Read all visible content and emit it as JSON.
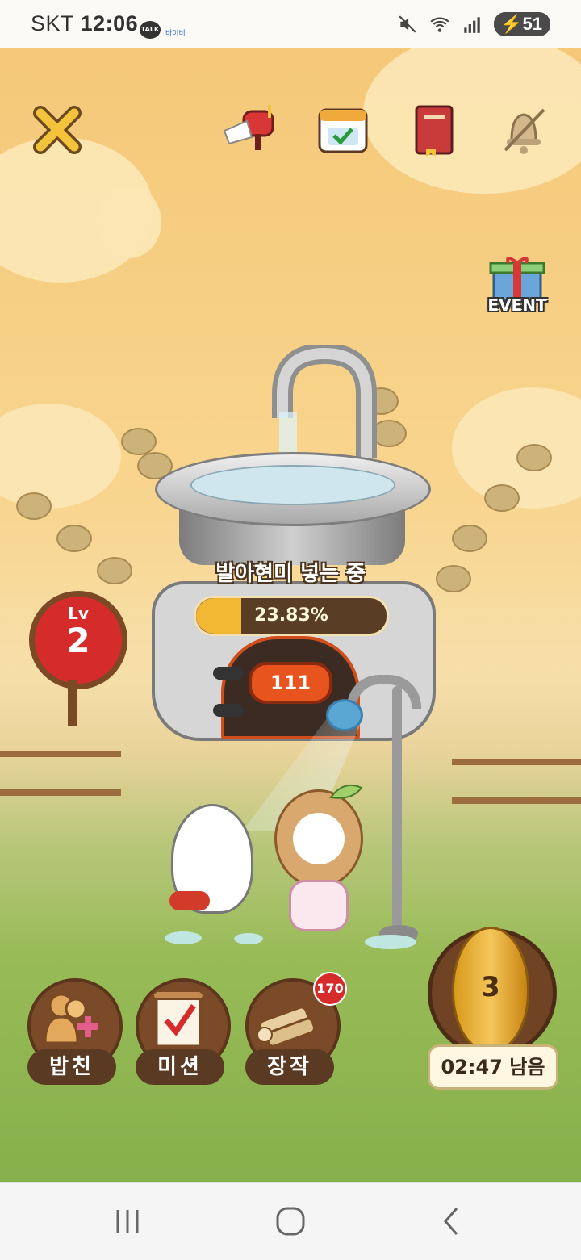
{
  "status_bar": {
    "carrier": "SKT",
    "time": "12:06",
    "talk_icon_label": "TALK",
    "app_badge": "바이비",
    "battery": "51"
  },
  "top_bar": {
    "event_label": "EVENT"
  },
  "machine": {
    "status_text": "발아현미 넣는 중",
    "progress_percent_text": "23.83%",
    "progress_fraction": 0.2383,
    "counter": "111"
  },
  "level": {
    "prefix": "Lv",
    "value": "2"
  },
  "bottom_menu": {
    "friends_label": "밥친",
    "mission_label": "미션",
    "firewood_label": "장작",
    "firewood_badge": "170",
    "seed_count": "3",
    "timer_text": "02:47 남음"
  },
  "colors": {
    "sky": "#f5c878",
    "grass": "#86b04b",
    "accent_red": "#d62b2b",
    "progress_fill": "#f2b733",
    "wood_brown": "#5a3a22"
  }
}
